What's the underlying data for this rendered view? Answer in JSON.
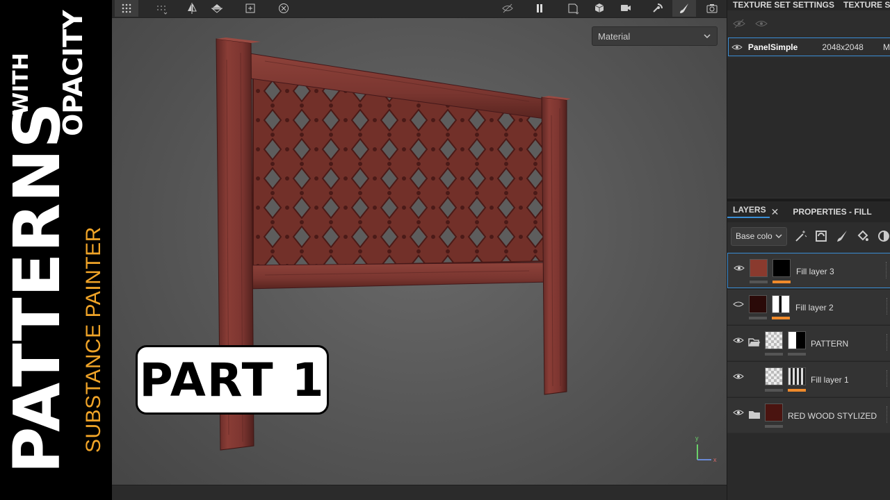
{
  "banner": {
    "patterns": "PATTERNS",
    "with": "WITH",
    "opacity": "OPACITY",
    "substance": "SUBSTANCE PAINTER",
    "accent_color": "#f0a428"
  },
  "viewport": {
    "material_select": "Material",
    "part_label": "PART 1",
    "axis_y": "y",
    "axis_x": "x"
  },
  "right_panel": {
    "tabs": [
      "TEXTURE SET SETTINGS",
      "TEXTURE SE"
    ],
    "texture_set": {
      "name": "PanelSimple",
      "resolution": "2048x2048",
      "extra": "M"
    },
    "layers_tabs": {
      "layers": "LAYERS",
      "properties": "PROPERTIES - FILL"
    },
    "channel": "Base colo",
    "layers": [
      {
        "name": "Fill layer 3",
        "selected": true,
        "color": "#8a3a2e"
      },
      {
        "name": "Fill layer 2",
        "selected": false,
        "color": "#2a0a08"
      },
      {
        "name": "PATTERN",
        "selected": false,
        "color": ""
      },
      {
        "name": "Fill layer 1",
        "selected": false,
        "color": ""
      },
      {
        "name": "RED WOOD STYLIZED",
        "selected": false,
        "color": "#4a1410"
      }
    ]
  },
  "colors": {
    "accent_blue": "#3a8ed6",
    "mask_orange": "#ef8a2b",
    "wood": "#7a3530"
  }
}
